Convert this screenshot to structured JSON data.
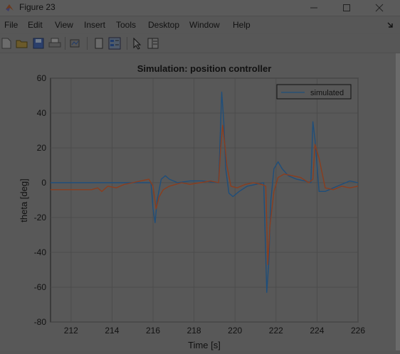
{
  "window": {
    "title": "Figure 23",
    "controls": [
      "minimize-icon",
      "maximize-icon",
      "close-icon"
    ]
  },
  "menu": [
    "File",
    "Edit",
    "View",
    "Insert",
    "Tools",
    "Desktop",
    "Window",
    "Help"
  ],
  "toolbar": {
    "icons": [
      "new-figure-icon",
      "open-file-icon",
      "save-icon",
      "print-icon",
      "link-plot-icon",
      "dock-toggle-icon",
      "legend-toggle-icon",
      "select-pointer-icon",
      "property-editor-icon"
    ]
  },
  "colors": {
    "simulated": "#1f4e7a",
    "measured": "#8a3d1e"
  },
  "chart_data": {
    "type": "line",
    "title": "Simulation: position controller",
    "xlabel": "Time [s]",
    "ylabel": "theta [deg]",
    "xlim": [
      211,
      226
    ],
    "ylim": [
      -80,
      60
    ],
    "xticks": [
      "212",
      "214",
      "216",
      "218",
      "220",
      "222",
      "224",
      "226"
    ],
    "yticks": [
      "60",
      "40",
      "20",
      "0",
      "-20",
      "-40",
      "-60",
      "-80"
    ],
    "grid": true,
    "legend": {
      "position": "top-right",
      "entries": [
        "simulated"
      ]
    },
    "series": [
      {
        "name": "simulated",
        "x": [
          211,
          215.9,
          216.0,
          216.1,
          216.2,
          216.4,
          216.6,
          216.8,
          217.2,
          217.8,
          218.4,
          219.2,
          219.35,
          219.45,
          219.55,
          219.7,
          219.9,
          220.2,
          220.6,
          221.0,
          221.4,
          221.55,
          221.65,
          221.75,
          221.9,
          222.1,
          222.3,
          222.6,
          223.0,
          223.4,
          223.7,
          223.8,
          223.9,
          224.1,
          224.4,
          224.8,
          225.2,
          225.6,
          226
        ],
        "y": [
          0,
          0,
          -15,
          -23,
          -10,
          2,
          4,
          2,
          0,
          1,
          1,
          0,
          52,
          35,
          8,
          -6,
          -8,
          -5,
          -2,
          -1,
          0,
          -63,
          -45,
          -10,
          8,
          12,
          8,
          4,
          2,
          1,
          0,
          35,
          25,
          -5,
          -5,
          -3,
          -1,
          1,
          0
        ]
      },
      {
        "name": "",
        "x": [
          211,
          212.0,
          213.0,
          213.3,
          213.5,
          213.8,
          214.2,
          214.6,
          215.0,
          215.4,
          215.8,
          216.0,
          216.15,
          216.3,
          216.5,
          216.8,
          217.1,
          217.4,
          217.8,
          218.3,
          218.8,
          219.2,
          219.3,
          219.4,
          219.5,
          219.6,
          219.8,
          220.1,
          220.5,
          220.9,
          221.3,
          221.5,
          221.6,
          221.7,
          221.9,
          222.1,
          222.4,
          222.8,
          223.2,
          223.6,
          223.8,
          223.9,
          224.1,
          224.4,
          224.8,
          225.2,
          225.6,
          226
        ],
        "y": [
          -4,
          -4,
          -4,
          -3,
          -5,
          -2,
          -3,
          -1,
          0,
          1,
          2,
          -2,
          -15,
          -8,
          -4,
          -2,
          -1,
          0,
          -1,
          0,
          1,
          0,
          20,
          33,
          22,
          10,
          -2,
          -3,
          -1,
          0,
          -1,
          -2,
          -47,
          -25,
          -5,
          3,
          5,
          4,
          3,
          0,
          2,
          22,
          14,
          -3,
          -4,
          -2,
          -3,
          -2
        ]
      }
    ]
  }
}
